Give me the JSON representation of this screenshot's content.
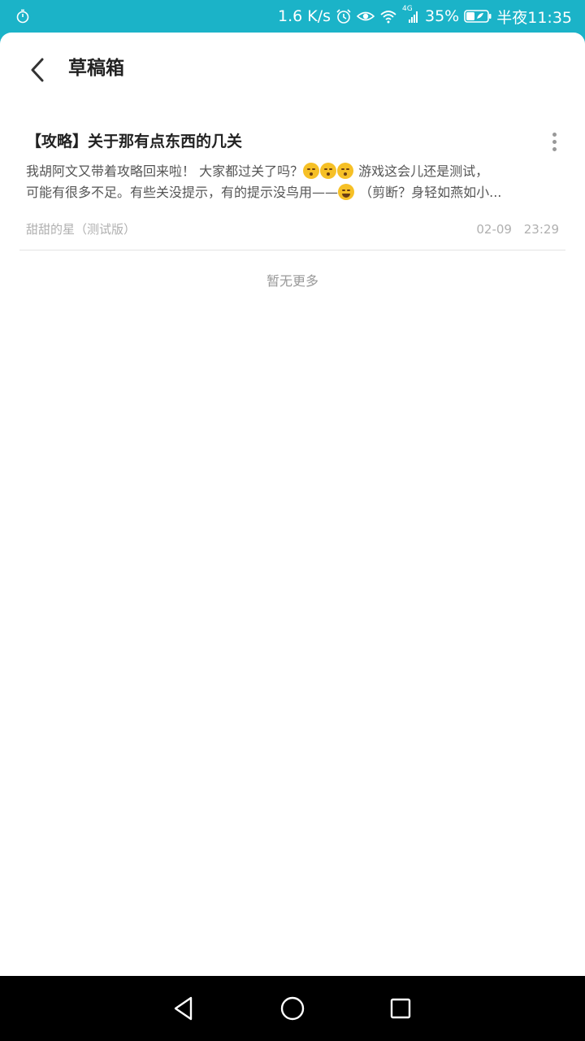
{
  "status_bar": {
    "net_speed": "1.6 K/s",
    "network_type": "4G",
    "battery_percent": "35%",
    "time": "半夜11:35",
    "icons": [
      "stopwatch-icon",
      "alarm-icon",
      "eye-icon",
      "wifi-icon",
      "signal-icon",
      "battery-icon"
    ]
  },
  "header": {
    "title": "草稿箱",
    "back_icon": "chevron-left-icon"
  },
  "drafts": [
    {
      "title": "【攻略】关于那有点东西的几关",
      "body_line1_a": "我胡阿文又带着攻略回来啦！  大家都过关了吗？",
      "body_line1_b": "  游戏这会儿还是测试，",
      "body_line2_a": "可能有很多不足。有些关没提示，有的提示没鸟用——",
      "body_line2_b": " （剪断？身轻如燕如小...",
      "author": "甜甜的星（测试版）",
      "date": "02-09",
      "time": "23:29"
    }
  ],
  "list_footer": "暂无更多",
  "nav": {
    "back_icon": "triangle-back-icon",
    "home_icon": "circle-home-icon",
    "recents_icon": "square-recents-icon"
  },
  "colors": {
    "status_bar": "#1bb3c8",
    "background": "#ffffff",
    "nav_bar": "#000000"
  }
}
